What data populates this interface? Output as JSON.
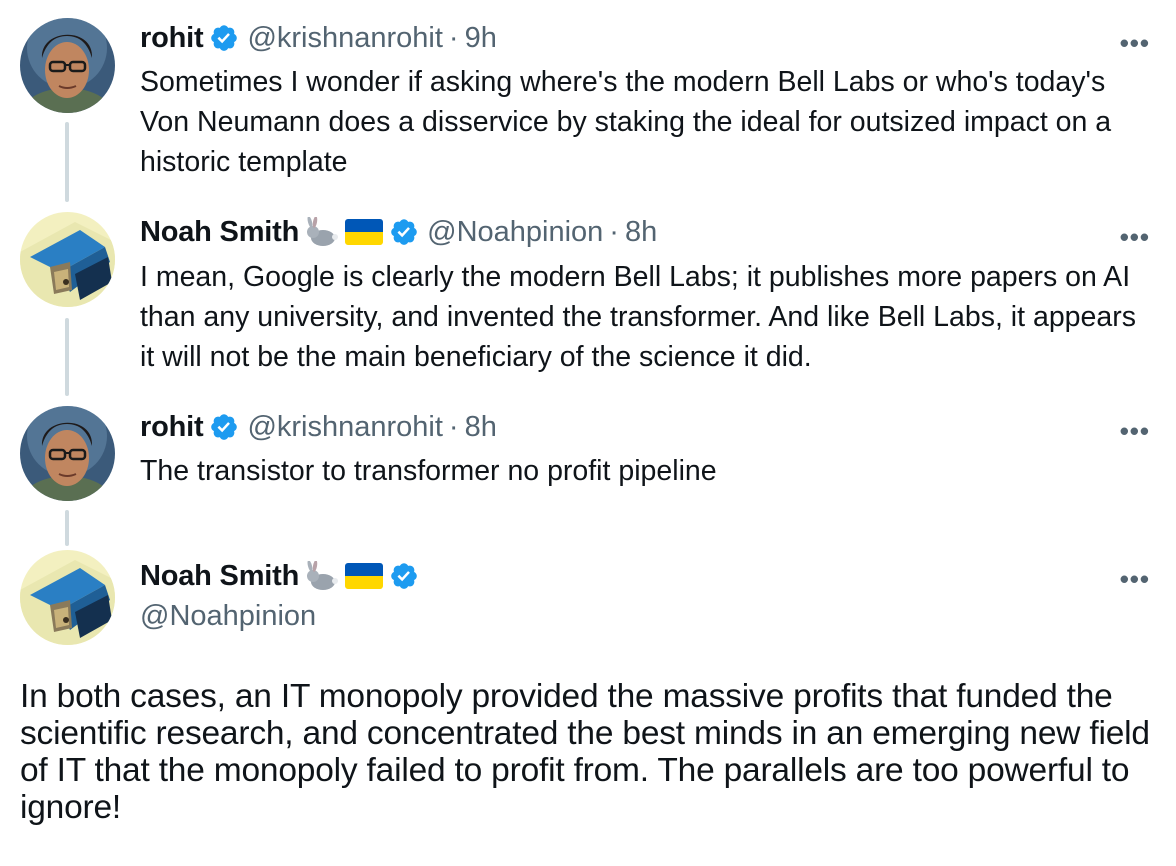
{
  "thread": [
    {
      "name": "rohit",
      "handle": "@krishnanrohit",
      "time": "9h",
      "text": "Sometimes I wonder if asking where's the modern Bell Labs or who's today's Von Neumann does a disservice by staking the ideal for outsized impact on a historic template",
      "avatar": "rohit-avatar"
    },
    {
      "name": "Noah Smith",
      "handle": "@Noahpinion",
      "time": "8h",
      "text": "I mean, Google is clearly the modern Bell Labs; it publishes more papers on AI than any university, and invented the transformer. And like Bell Labs, it appears it will not be the main beneficiary of the science it did.",
      "emoji": [
        "rabbit",
        "ukraine-flag"
      ],
      "avatar": "noah-avatar"
    },
    {
      "name": "rohit",
      "handle": "@krishnanrohit",
      "time": "8h",
      "text": "The transistor to transformer no profit pipeline",
      "avatar": "rohit-avatar"
    }
  ],
  "main_tweet": {
    "name": "Noah Smith",
    "handle": "@Noahpinion",
    "emoji": [
      "rabbit",
      "ukraine-flag"
    ],
    "text": "In both cases, an IT monopoly provided the massive profits that funded the scientific research, and concentrated the best minds in an emerging new field of IT that the monopoly failed to profit from. The parallels are too powerful to ignore!",
    "avatar": "noah-avatar"
  },
  "separator": "·",
  "more_label": "•••",
  "colors": {
    "text": "#0f1419",
    "secondary": "#536471",
    "verified": "#1d9bf0",
    "thread_line": "#cfd9de",
    "flag_blue": "#0057b7",
    "flag_yellow": "#ffd700"
  }
}
